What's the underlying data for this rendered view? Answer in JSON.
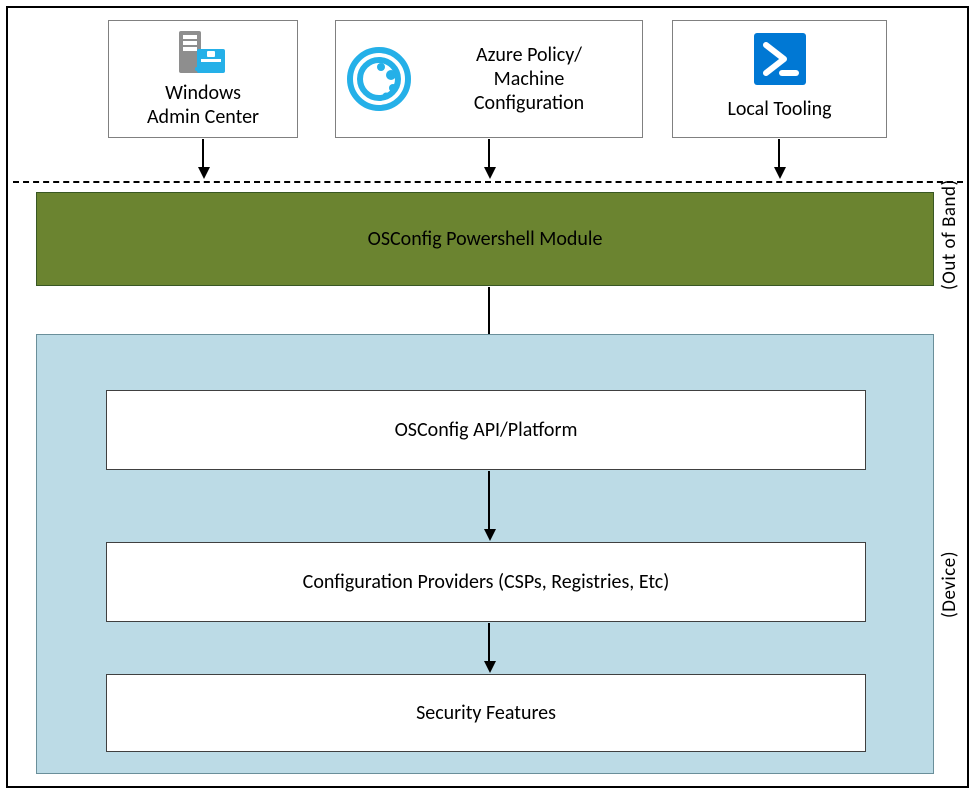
{
  "top_boxes": {
    "wac": {
      "line1": "Windows",
      "line2": "Admin Center"
    },
    "azure": {
      "line1": "Azure Policy/",
      "line2": "Machine",
      "line3": "Configuration"
    },
    "local": {
      "label": "Local Tooling"
    }
  },
  "ps_module": {
    "label": "OSConfig Powershell Module"
  },
  "device_boxes": {
    "api": {
      "label": "OSConfig API/Platform"
    },
    "providers": {
      "label": "Configuration Providers (CSPs, Registries, Etc)"
    },
    "security": {
      "label": "Security Features"
    }
  },
  "side_labels": {
    "oob": "(Out of Band)",
    "device": "(Device)"
  }
}
